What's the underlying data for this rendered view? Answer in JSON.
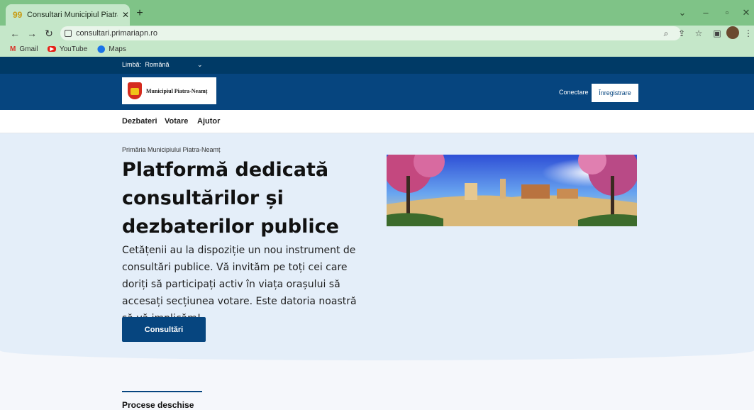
{
  "browser": {
    "tab_title": "Consultari Municipiul Piatra-Neam",
    "new_tab": "+",
    "url": "consultari.primariapn.ro",
    "bookmarks": [
      "Gmail",
      "YouTube",
      "Maps"
    ]
  },
  "site": {
    "language_label": "Limbă:",
    "language_value": "Română",
    "logo_text": "Municipiul Piatra-Neamț",
    "login": "Conectare",
    "register": "Înregistrare",
    "menu": [
      "Dezbateri",
      "Votare",
      "Ajutor"
    ],
    "hero": {
      "kicker": "Primăria Municipiului Piatra-Neamț",
      "title": "Platformă dedicată consultărilor și dezbaterilor publice",
      "lead": "Cetățenii au la dispoziție un nou instrument de consultări publice. Vă invităm pe toți cei care doriți să participați activ în viața orașului să accesați secțiunea votare. Este datoria noastră să vă implicăm!",
      "cta": "Consultări"
    },
    "section_title": "Procese deschise"
  }
}
